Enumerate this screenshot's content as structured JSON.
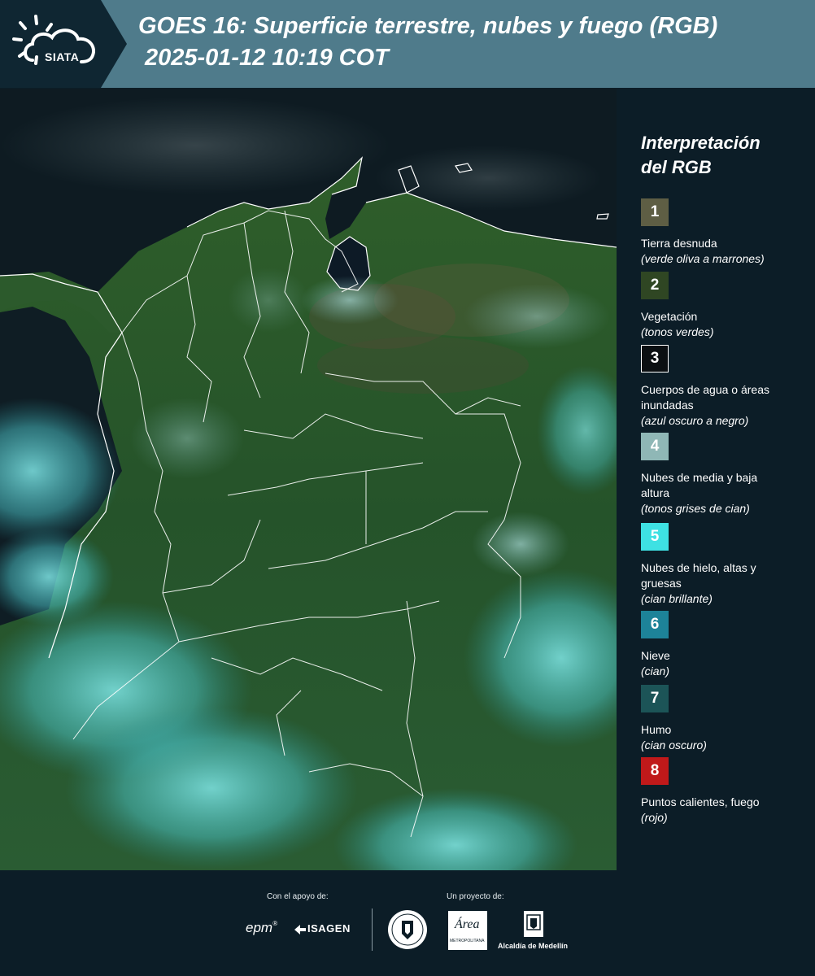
{
  "header": {
    "logo_text": "SIATA",
    "title_line1": "GOES 16: Superficie terrestre, nubes y fuego (RGB)",
    "title_line2": "2025-01-12 10:19 COT"
  },
  "map": {
    "image": "satellite-rgb-composite-colombia",
    "boundary_color": "#ffffff"
  },
  "legend": {
    "title_line1": "Interpretación",
    "title_line2": "del RGB",
    "items": [
      {
        "number": "1",
        "color": "#5e5e44",
        "label": "Tierra desnuda",
        "note": "(verde oliva a marrones)"
      },
      {
        "number": "2",
        "color": "#2f4623",
        "label": "Vegetación",
        "note": "(tonos verdes)"
      },
      {
        "number": "3",
        "color": "#0b0f12",
        "label": "Cuerpos de agua o áreas inundadas",
        "note": "(azul oscuro a negro)"
      },
      {
        "number": "4",
        "color": "#8fb7b6",
        "label": "Nubes de media y baja altura",
        "note": "(tonos grises de cian)"
      },
      {
        "number": "5",
        "color": "#3ee1e3",
        "label": "Nubes de hielo, altas y gruesas",
        "note": "(cian brillante)"
      },
      {
        "number": "6",
        "color": "#1d8399",
        "label": "Nieve",
        "note": "(cian)"
      },
      {
        "number": "7",
        "color": "#1c5457",
        "label": "Humo",
        "note": "(cian oscuro)"
      },
      {
        "number": "8",
        "color": "#c0191a",
        "label": "Puntos calientes, fuego",
        "note": "(rojo)"
      }
    ]
  },
  "footer": {
    "support_label": "Con el apoyo de:",
    "project_label": "Un proyecto de:",
    "sponsors": {
      "epm": "epm",
      "isagen": "ISAGEN",
      "metropolitana_title": "Área",
      "metropolitana_sub": "METROPOLITANA",
      "alcaldia": "Alcaldía de Medellín"
    }
  }
}
